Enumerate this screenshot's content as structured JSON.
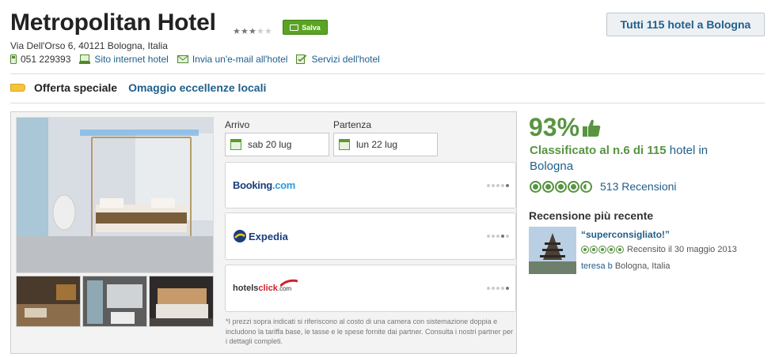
{
  "hotel": {
    "name": "Metropolitan Hotel",
    "stars": 3,
    "stars_max": 5,
    "save_label": "Salva",
    "address": "Via Dell'Orso 6, 40121 Bologna, Italia",
    "phone": "051 229393",
    "website_label": "Sito internet hotel",
    "email_label": "Invia un'e-mail all'hotel",
    "services_label": "Servizi dell'hotel",
    "all_hotels_label": "Tutti 115 hotel a Bologna"
  },
  "offer": {
    "label": "Offerta speciale",
    "value": "Omaggio eccellenze locali"
  },
  "booking": {
    "checkin_label": "Arrivo",
    "checkin_value": "sab 20 lug",
    "checkout_label": "Partenza",
    "checkout_value": "lun 22 lug",
    "partners": [
      {
        "name": "Booking.com"
      },
      {
        "name": "Expedia"
      },
      {
        "name": "hotelsclick.com"
      }
    ],
    "disclaimer": "*I prezzi sopra indicati si riferiscono al costo di una camera con sistemazione doppia e includono la tariffa base, le tasse e le spese fornite dai partner. Consulta i nostri partner per i dettagli completi."
  },
  "rating": {
    "percent": "93%",
    "rank_prefix": "Classificato al n.6 di 115",
    "rank_suffix": "hotel in Bologna",
    "bubbles": 4.5,
    "reviews_label": "513 Recensioni"
  },
  "recent_review": {
    "heading": "Recensione più recente",
    "title": "“superconsigliato!”",
    "bubbles": 5,
    "date": "Recensito il 30 maggio 2013",
    "author": "teresa b",
    "location": "Bologna, Italia"
  },
  "colors": {
    "green": "#589442",
    "link": "#1f5f8b",
    "save_button": "#5ba423"
  }
}
